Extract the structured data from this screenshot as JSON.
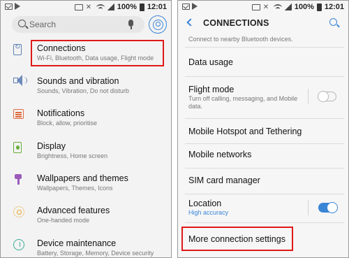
{
  "status_bar": {
    "battery_percent": "100%",
    "time": "12:01"
  },
  "left_screen": {
    "search_placeholder": "Search",
    "items": [
      {
        "title": "Connections",
        "subtitle": "Wi-Fi, Bluetooth, Data usage, Flight mode",
        "icon": "connections-icon",
        "color": "#5d7fb5",
        "highlighted": true
      },
      {
        "title": "Sounds and vibration",
        "subtitle": "Sounds, Vibration, Do not disturb",
        "icon": "speaker-icon",
        "color": "#5d7fb5"
      },
      {
        "title": "Notifications",
        "subtitle": "Block, allow, prioritise",
        "icon": "notifications-icon",
        "color": "#e06a3e"
      },
      {
        "title": "Display",
        "subtitle": "Brightness, Home screen",
        "icon": "display-icon",
        "color": "#6aae3a"
      },
      {
        "title": "Wallpapers and themes",
        "subtitle": "Wallpapers, Themes, Icons",
        "icon": "paint-brush-icon",
        "color": "#9a5ab8"
      },
      {
        "title": "Advanced features",
        "subtitle": "One-handed mode",
        "icon": "gear-icon",
        "color": "#e5a526"
      },
      {
        "title": "Device maintenance",
        "subtitle": "Battery, Storage, Memory, Device security",
        "icon": "device-maintenance-icon",
        "color": "#3eaa9a"
      }
    ]
  },
  "right_screen": {
    "title": "CONNECTIONS",
    "top_partial_subtitle": "Connect to nearby Bluetooth devices.",
    "items": [
      {
        "title": "Data usage"
      },
      {
        "title": "Flight mode",
        "subtitle": "Turn off calling, messaging, and Mobile data.",
        "toggle": "off"
      },
      {
        "title": "Mobile Hotspot and Tethering"
      },
      {
        "title": "Mobile networks"
      },
      {
        "title": "SIM card manager"
      },
      {
        "title": "Location",
        "subtitle": "High accuracy",
        "toggle": "on"
      },
      {
        "title": "More connection settings",
        "highlighted": true
      }
    ],
    "accent_color": "#3a85d6",
    "highlight_color": "#e01818"
  }
}
